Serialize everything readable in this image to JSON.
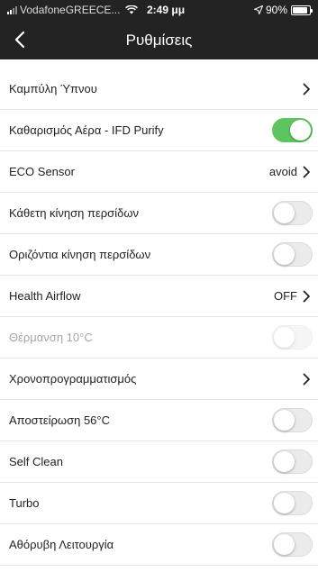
{
  "status_bar": {
    "carrier": "VodafoneGREECE...",
    "time": "2:49 μμ",
    "battery": "90%",
    "battery_level": 0.9
  },
  "nav": {
    "title": "Ρυθμίσεις",
    "back_icon": "chevron-left-icon"
  },
  "colors": {
    "header_bg": "#232323",
    "toggle_on": "#5ec45f",
    "toggle_off": "#ebebeb"
  },
  "settings": [
    {
      "label": "Καμπύλη Ύπνου",
      "control": "chevron",
      "value": ""
    },
    {
      "label": "Καθαρισμός Αέρα - IFD Purify",
      "control": "toggle",
      "on": true
    },
    {
      "label": "ECO Sensor",
      "control": "chevron",
      "value": "avoid"
    },
    {
      "label": "Κάθετη κίνηση περσίδων",
      "control": "toggle",
      "on": false
    },
    {
      "label": "Οριζόντια κίνηση περσίδων",
      "control": "toggle",
      "on": false
    },
    {
      "label": "Health Airflow",
      "control": "chevron",
      "value": "OFF"
    },
    {
      "label": "Θέρμανση 10°C",
      "control": "toggle",
      "on": false,
      "disabled": true
    },
    {
      "label": "Χρονοπρογραμματισμός",
      "control": "chevron",
      "value": ""
    },
    {
      "label": "Αποστείρωση 56°C",
      "control": "toggle",
      "on": false
    },
    {
      "label": "Self Clean",
      "control": "toggle",
      "on": false
    },
    {
      "label": "Turbo",
      "control": "toggle",
      "on": false
    },
    {
      "label": "Αθόρυβη Λειτουργία",
      "control": "toggle",
      "on": false
    }
  ]
}
